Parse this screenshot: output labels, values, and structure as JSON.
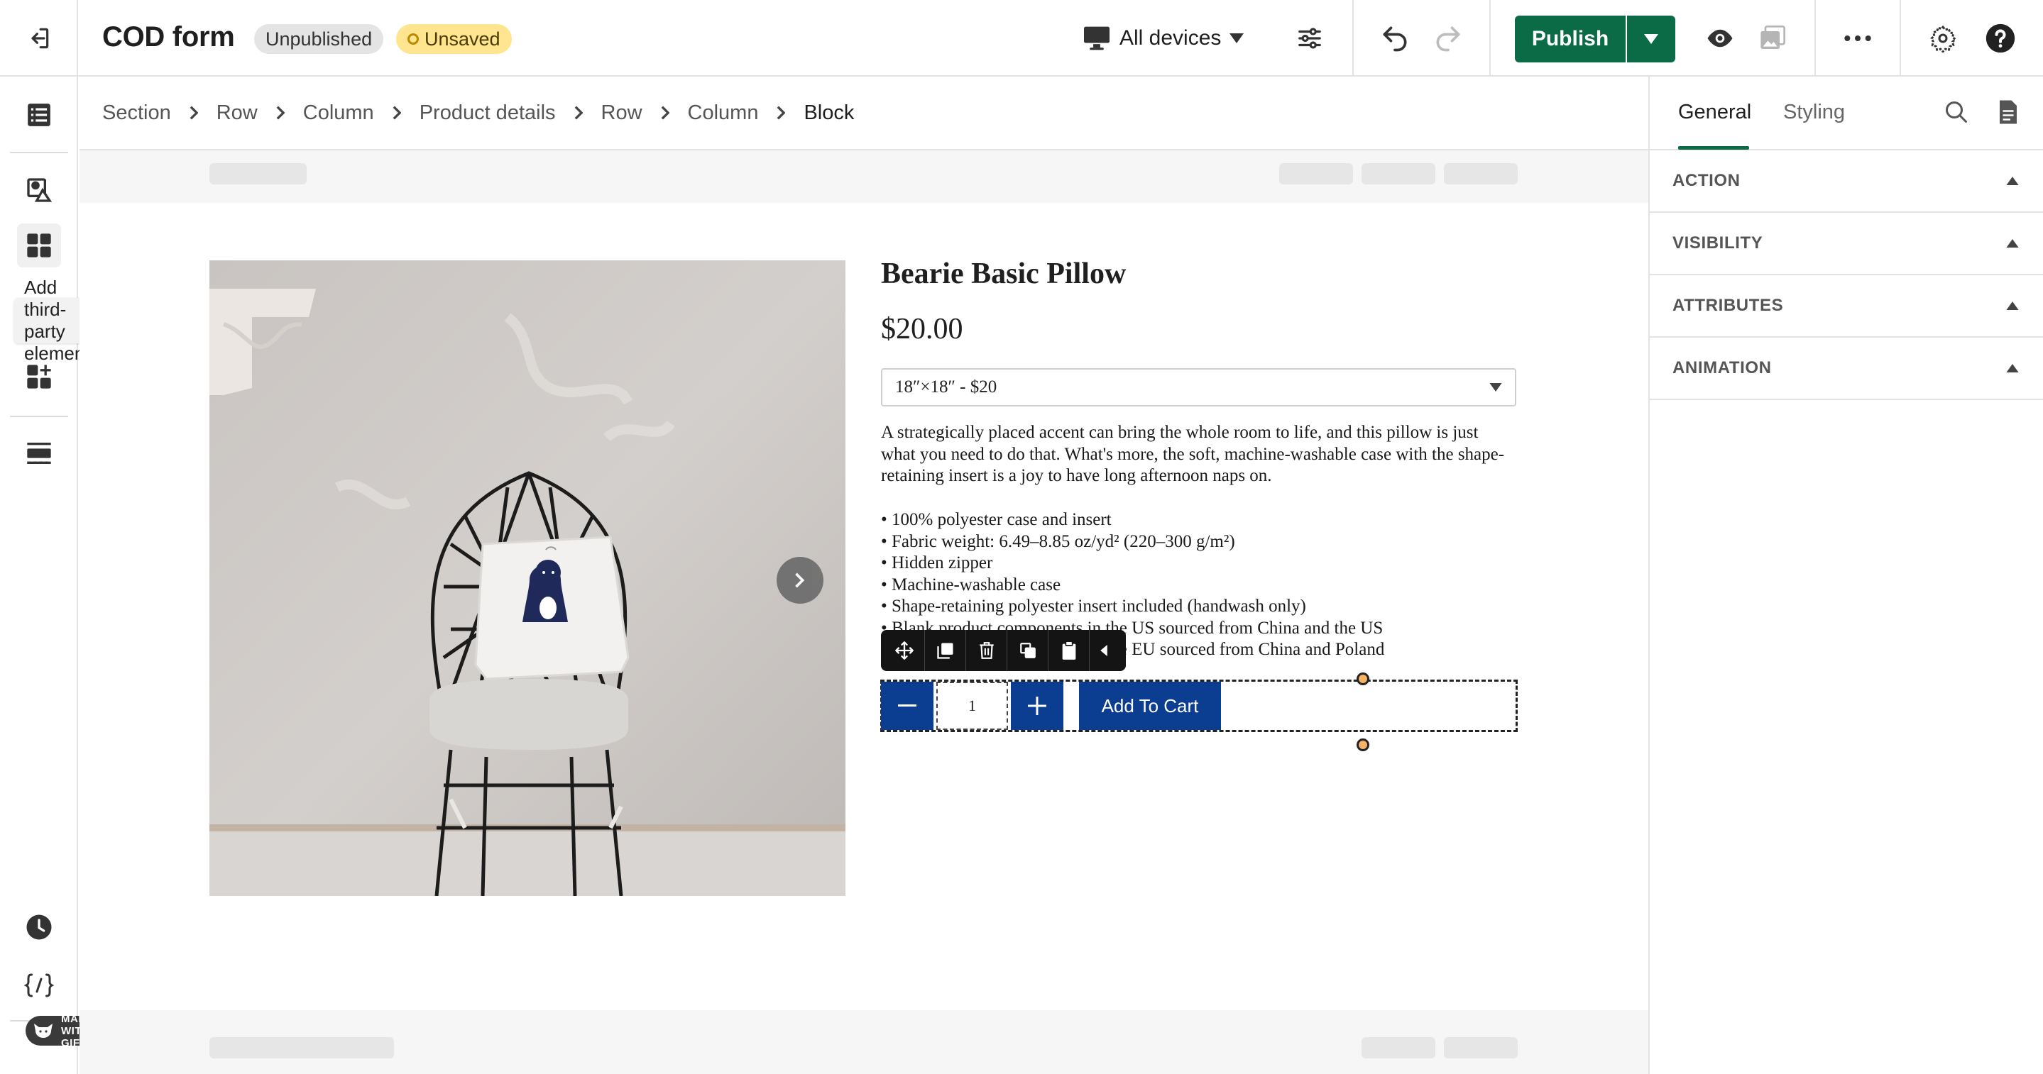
{
  "topbar": {
    "title": "COD form",
    "badge_unpublished": "Unpublished",
    "badge_unsaved": "Unsaved",
    "devices_label": "All devices",
    "publish_label": "Publish"
  },
  "left_rail": {
    "tooltip": "Add third-party elements",
    "gifox_label": "MADE WITH GIFOX"
  },
  "breadcrumb": [
    "Section",
    "Row",
    "Column",
    "Product details",
    "Row",
    "Column",
    "Block"
  ],
  "product": {
    "title": "Bearie Basic Pillow",
    "price": "$20.00",
    "variant": "18″×18″ - $20",
    "description": "A strategically placed accent can bring the whole room to life, and this pillow is just what you need to do that. What's more, the soft, machine-washable case with the shape-retaining insert is a joy to have long afternoon naps on.",
    "bullets": [
      "• 100% polyester case and insert",
      "• Fabric weight: 6.49–8.85 oz/yd² (220–300 g/m²)",
      "• Hidden zipper",
      "• Machine-washable case",
      "• Shape-retaining polyester insert included (handwash only)",
      "• Blank product components in the US sourced from China and the US",
      "• Blank product components in the EU sourced from China and Poland"
    ],
    "quantity": "1",
    "add_to_cart": "Add To Cart"
  },
  "right_panel": {
    "tabs": [
      "General",
      "Styling"
    ],
    "sections": [
      "ACTION",
      "VISIBILITY",
      "ATTRIBUTES",
      "ANIMATION"
    ]
  },
  "colors": {
    "publish_green": "#0c6b47",
    "cart_blue": "#0b3d91",
    "unsaved_yellow": "#ffe58f",
    "notification_red": "#e32727"
  }
}
